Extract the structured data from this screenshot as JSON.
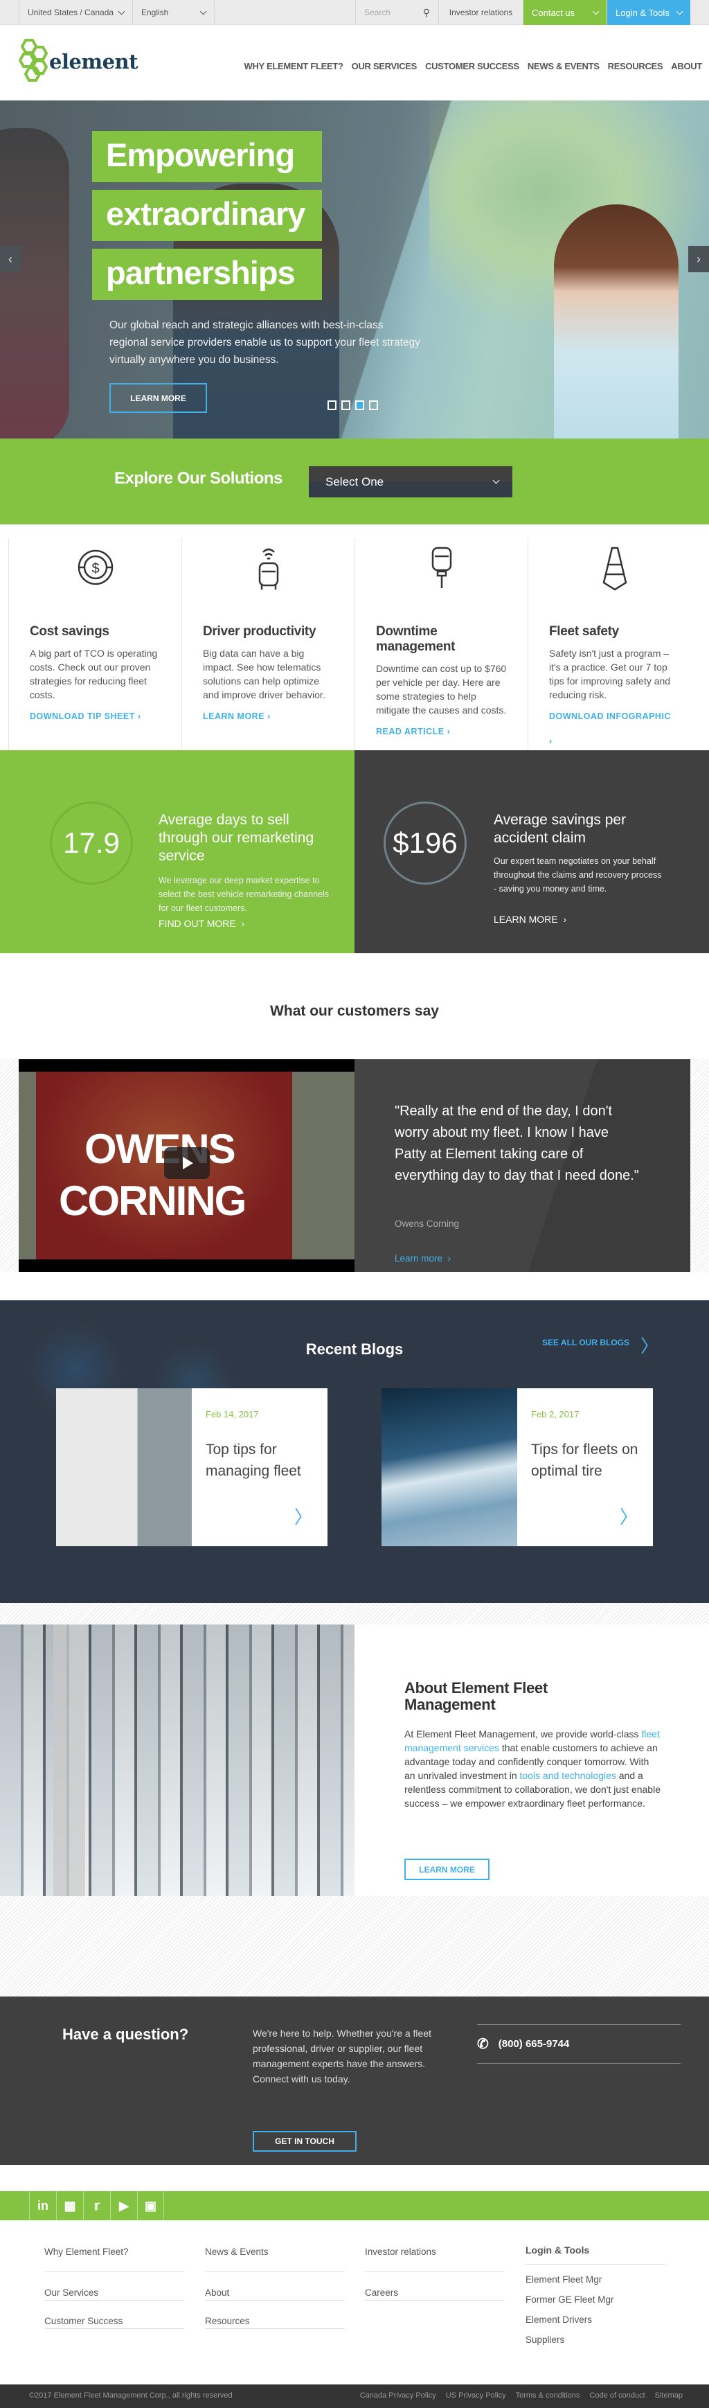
{
  "colors": {
    "brand_green": "#84c341",
    "accent_blue": "#41b0e8",
    "dark": "#404040",
    "navy": "#2f3846"
  },
  "topbar": {
    "region": "United States / Canada",
    "language": "English",
    "search_placeholder": "Search",
    "investor": "Investor relations",
    "contact": "Contact us",
    "login": "Login & Tools"
  },
  "header": {
    "logo": "element",
    "nav": [
      "WHY ELEMENT FLEET?",
      "OUR SERVICES",
      "CUSTOMER SUCCESS",
      "NEWS & EVENTS",
      "RESOURCES",
      "ABOUT"
    ]
  },
  "hero": {
    "title_lines": [
      "Empowering",
      "extraordinary",
      "partnerships"
    ],
    "text": "Our global reach and strategic alliances with best-in-class regional service providers enable us to support your fleet strategy virtually anywhere you do business.",
    "button": "LEARN MORE",
    "slides": 4,
    "active_slide": 3,
    "prev": "‹",
    "next": "›"
  },
  "explore": {
    "title": "Explore Our Solutions",
    "select": "Select One"
  },
  "cards": [
    {
      "icon": "dollar-coin-icon",
      "title": "Cost savings",
      "text": "A big part of TCO is operating costs. Check out our proven strategies for reducing fleet costs.",
      "link": "DOWNLOAD TIP SHEET"
    },
    {
      "icon": "connected-car-icon",
      "title": "Driver productivity",
      "text": "Big data can have a big impact. See how telematics solutions can help optimize and improve driver behavior.",
      "link": "LEARN MORE"
    },
    {
      "icon": "car-lift-icon",
      "title": "Downtime management",
      "text": "Downtime can cost up to $760 per vehicle per day. Here are some strategies to help mitigate the causes and costs.",
      "link": "READ ARTICLE"
    },
    {
      "icon": "traffic-cone-icon",
      "title": "Fleet safety",
      "text": "Safety isn't just a program – it's a practice. Get our 7 top tips for improving safety and reducing risk.",
      "link": "DOWNLOAD INFOGRAPHIC"
    }
  ],
  "stats": [
    {
      "value": "17.9",
      "title": "Average days to sell through our remarketing service",
      "text": "We leverage our deep market expertise to select the best vehicle remarketing channels for our fleet customers.",
      "link": "FIND OUT MORE"
    },
    {
      "value": "$196",
      "title": "Average savings per accident claim",
      "text": "Our expert team negotiates on your behalf throughout the claims and recovery process - saving you money and time.",
      "link": "LEARN MORE"
    }
  ],
  "testimonial": {
    "title": "What our customers say",
    "video_words": [
      "OWENS",
      "CORNING"
    ],
    "quote": "\"Really at the end of the day, I don't worry about my fleet. I know I have Patty at Element taking care of everything day to day that I need done.\"",
    "author": "Owens Corning",
    "link": "Learn more"
  },
  "blogs": {
    "title": "Recent Blogs",
    "see_all": "SEE ALL OUR BLOGS",
    "items": [
      {
        "date": "Feb 14, 2017",
        "title": "Top tips for managing fleet"
      },
      {
        "date": "Feb 2, 2017",
        "title": "Tips for fleets on optimal tire"
      }
    ]
  },
  "about": {
    "title": "About Element Fleet Management",
    "text_1": "At Element Fleet Management, we provide world-class ",
    "link_1": "fleet management services",
    "text_2": " that enable customers to achieve an advantage today and confidently conquer tomorrow. With an unrivaled investment in ",
    "link_2": "tools and technologies",
    "text_3": " and a relentless commitment to collaboration, we don't just enable success – we empower extraordinary fleet performance.",
    "button": "LEARN MORE"
  },
  "question": {
    "title": "Have a question?",
    "text": "We're here to help. Whether you're a fleet professional, driver or supplier, our fleet management experts have the answers. Connect with us today.",
    "phone": "(800) 665-9744",
    "button": "GET IN TOUCH"
  },
  "footer": {
    "social": [
      "linkedin-icon",
      "slideshare-icon",
      "twitter-icon",
      "youtube-icon",
      "instagram-icon"
    ],
    "col1": [
      "Why Element Fleet?",
      "Our Services",
      "Customer Success"
    ],
    "col2": [
      "News & Events",
      "About",
      "Resources"
    ],
    "col3": [
      "Investor relations",
      "Careers"
    ],
    "tools_title": "Login & Tools",
    "tools": [
      "Element Fleet Mgr",
      "Former GE Fleet Mgr",
      "Element Drivers",
      "Suppliers"
    ],
    "copyright": "©2017 Element Fleet Management Corp., all rights reserved",
    "legal": [
      "Canada Privacy Policy",
      "US Privacy Policy",
      "Terms & conditions",
      "Code of conduct",
      "Sitemap"
    ]
  }
}
